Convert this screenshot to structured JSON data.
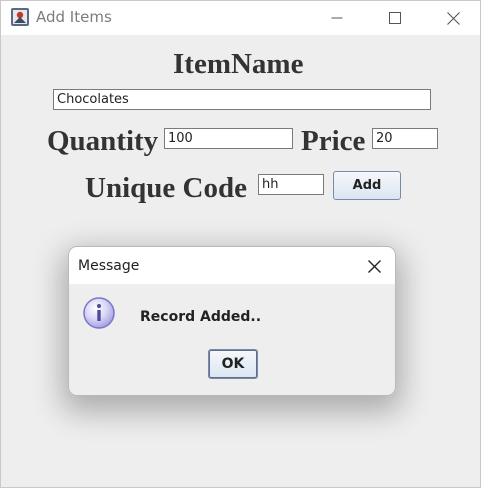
{
  "window": {
    "title": "Add Items",
    "icon": "java-app-icon",
    "controls": [
      "minimize-icon",
      "maximize-icon",
      "close-icon"
    ]
  },
  "form": {
    "item_name_label": "ItemName",
    "item_name_value": "Chocolates",
    "quantity_label": "Quantity",
    "quantity_value": "100",
    "price_label": "Price",
    "price_value": "20",
    "unique_code_label": "Unique Code",
    "unique_code_value": "hh",
    "add_button_label": "Add"
  },
  "dialog": {
    "title": "Message",
    "icon": "info-icon",
    "message": "Record Added..",
    "ok_button_label": "OK"
  },
  "colors": {
    "window_bg": "#eeeeee",
    "titlebar_bg": "#ffffff",
    "label_text": "#333333",
    "button_border": "#7a8aa6",
    "info_icon": "#8a86d8"
  }
}
